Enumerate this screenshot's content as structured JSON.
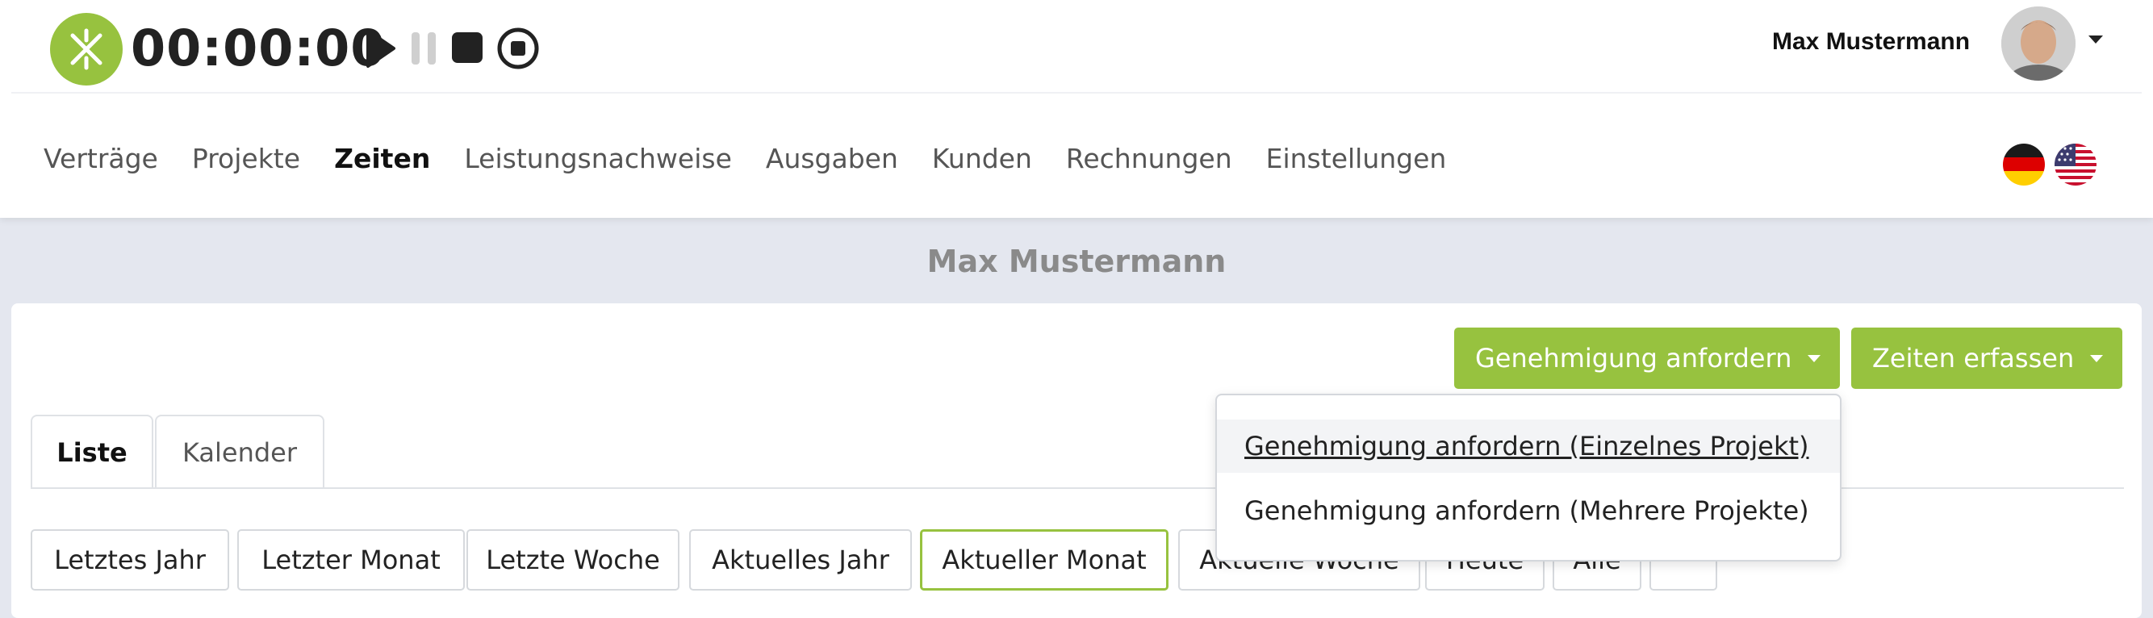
{
  "timer": {
    "display": "00:00:00"
  },
  "user": {
    "name": "Max Mustermann"
  },
  "nav": {
    "items": [
      {
        "label": "Verträge"
      },
      {
        "label": "Projekte"
      },
      {
        "label": "Zeiten"
      },
      {
        "label": "Leistungsnachweise"
      },
      {
        "label": "Ausgaben"
      },
      {
        "label": "Kunden"
      },
      {
        "label": "Rechnungen"
      },
      {
        "label": "Einstellungen"
      }
    ],
    "active": "Zeiten"
  },
  "page": {
    "title": "Max Mustermann"
  },
  "actions": {
    "request_approval_label": "Genehmigung anfordern",
    "record_times_label": "Zeiten erfassen"
  },
  "dropdown": {
    "items": [
      {
        "label": "Genehmigung anfordern (Einzelnes Projekt)"
      },
      {
        "label": "Genehmigung anfordern (Mehrere Projekte)"
      }
    ]
  },
  "tabs": [
    {
      "label": "Liste",
      "active": true
    },
    {
      "label": "Kalender",
      "active": false
    }
  ],
  "filters": [
    {
      "label": "Letztes Jahr"
    },
    {
      "label": "Letzter Monat"
    },
    {
      "label": "Letzte Woche"
    },
    {
      "label": "Aktuelles Jahr"
    },
    {
      "label": "Aktueller Monat"
    },
    {
      "label": "Aktuelle Woche"
    },
    {
      "label": "Heute"
    },
    {
      "label": "Alle"
    }
  ],
  "filter_active": "Aktueller Monat",
  "colors": {
    "brand": "#97c23f",
    "page_bg": "#e4e7ef"
  },
  "icons": {
    "logo": "logo-icon",
    "play": "play-icon",
    "pause": "pause-icon",
    "stop": "stop-icon",
    "record": "record-stop-icon",
    "flag_de": "flag-germany-icon",
    "flag_us": "flag-usa-icon",
    "person": "person-icon"
  }
}
